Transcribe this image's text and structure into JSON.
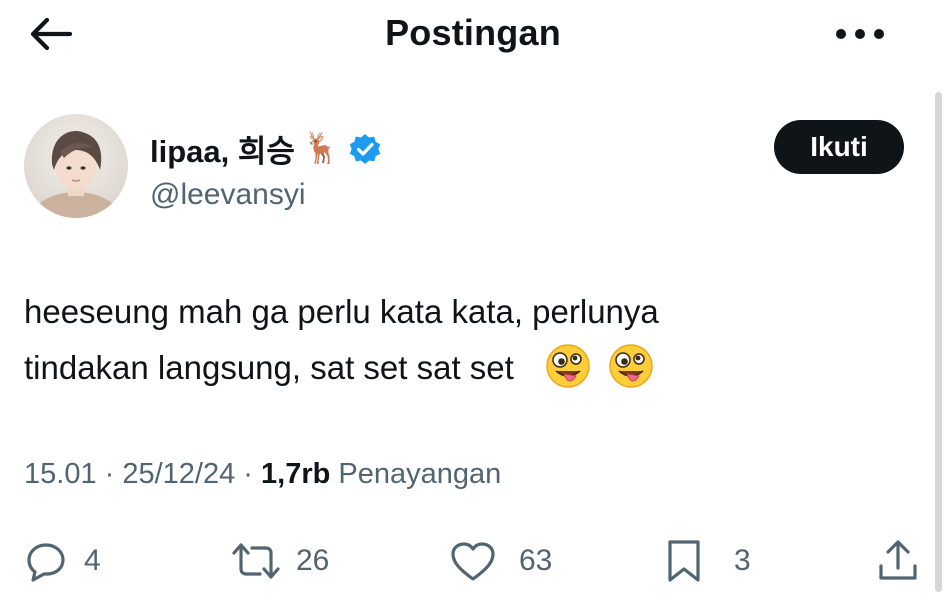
{
  "header": {
    "title": "Postingan",
    "back_icon": "arrow-left-icon",
    "more_icon": "more-horizontal-icon"
  },
  "author": {
    "name": "lipaa, 희승",
    "name_emoji": "🦌",
    "verified": true,
    "handle": "@leevansyi",
    "follow_label": "Ikuti"
  },
  "tweet": {
    "line1": "heeseung mah ga perlu kata kata, perlunya",
    "line2": "tindakan langsung, sat set sat set",
    "emojis": [
      "🤪",
      "🤪"
    ]
  },
  "meta": {
    "time": "15.01",
    "separator1": " · ",
    "date": "25/12/24",
    "separator2": " · ",
    "views_count": "1,7rb",
    "views_label": " Penayangan"
  },
  "actions": {
    "replies": "4",
    "reposts": "26",
    "likes": "63",
    "bookmarks": "3"
  },
  "colors": {
    "text_primary": "#0f1419",
    "text_secondary": "#536471",
    "verified_blue": "#1d9bf0",
    "follow_bg": "#0f1419"
  }
}
